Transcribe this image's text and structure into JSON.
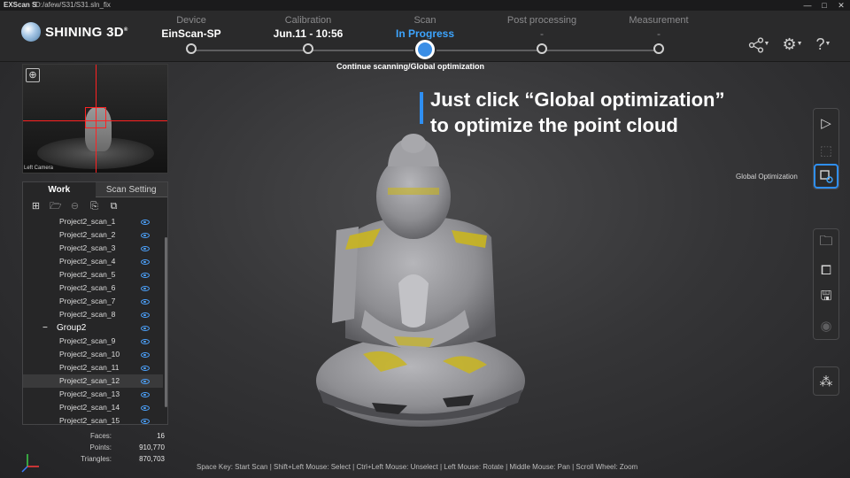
{
  "titlebar": {
    "app_name": "EXScan S",
    "path": "D:/afew/S31/S31.sln_fix",
    "minimize": "—",
    "maximize": "□",
    "close": "✕"
  },
  "brand": {
    "logo_text": "SHINING 3D",
    "registered": "®"
  },
  "steps": [
    {
      "label": "Device",
      "value": "EinScan-SP",
      "state": "done"
    },
    {
      "label": "Calibration",
      "value": "Jun.11 - 10:56",
      "state": "done"
    },
    {
      "label": "Scan",
      "value": "In Progress",
      "state": "active"
    },
    {
      "label": "Post processing",
      "value": "-",
      "state": "pending"
    },
    {
      "label": "Measurement",
      "value": "-",
      "state": "pending"
    }
  ],
  "step_subtitle": "Continue scanning/Global optimization",
  "header_icons": [
    "share-icon",
    "gear-icon",
    "help-icon"
  ],
  "camera": {
    "label": "Left Camera"
  },
  "work_panel": {
    "tabs": [
      "Work",
      "Scan Setting"
    ],
    "active_tab": "Work",
    "tools": [
      "add-project-icon",
      "open-folder-icon",
      "remove-icon",
      "new-group-icon",
      "merge-icon"
    ],
    "items": [
      {
        "name": "Project2_scan_1",
        "type": "scan"
      },
      {
        "name": "Project2_scan_2",
        "type": "scan"
      },
      {
        "name": "Project2_scan_3",
        "type": "scan"
      },
      {
        "name": "Project2_scan_4",
        "type": "scan"
      },
      {
        "name": "Project2_scan_5",
        "type": "scan"
      },
      {
        "name": "Project2_scan_6",
        "type": "scan"
      },
      {
        "name": "Project2_scan_7",
        "type": "scan"
      },
      {
        "name": "Project2_scan_8",
        "type": "scan"
      },
      {
        "name": "Group2",
        "type": "group",
        "toggle": "−"
      },
      {
        "name": "Project2_scan_9",
        "type": "scan"
      },
      {
        "name": "Project2_scan_10",
        "type": "scan"
      },
      {
        "name": "Project2_scan_11",
        "type": "scan"
      },
      {
        "name": "Project2_scan_12",
        "type": "scan",
        "selected": true
      },
      {
        "name": "Project2_scan_13",
        "type": "scan"
      },
      {
        "name": "Project2_scan_14",
        "type": "scan"
      },
      {
        "name": "Project2_scan_15",
        "type": "scan"
      }
    ]
  },
  "stats": [
    {
      "key": "Faces:",
      "value": "16"
    },
    {
      "key": "Points:",
      "value": "910,770"
    },
    {
      "key": "Triangles:",
      "value": "870,703"
    }
  ],
  "instruction": {
    "line1": "Just click “Global optimization”",
    "line2": "to optimize the point cloud",
    "accent": "#2f8ff2"
  },
  "right_toolbar": {
    "tooltip": "Global Optimization",
    "group1": [
      "play-icon",
      "select-region-icon",
      "global-optimization-icon"
    ],
    "group2": [
      "folder-icon",
      "puzzle-icon",
      "save-icon",
      "eye-icon"
    ],
    "group3": [
      "cloud-icon"
    ]
  },
  "status_bar": "Space Key: Start Scan | Shift+Left Mouse: Select | Ctrl+Left Mouse: Unselect | Left Mouse: Rotate | Middle Mouse: Pan | Scroll Wheel: Zoom",
  "colors": {
    "accent": "#3da5ff",
    "highlight_yellow": "#c9b520",
    "model_gray": "#9a9a9e"
  }
}
